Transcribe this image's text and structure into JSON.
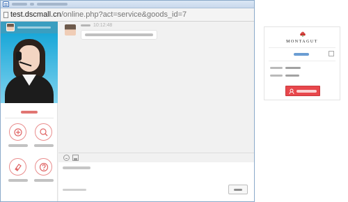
{
  "browser": {
    "url_host": "test.dscmall.cn",
    "url_path": "/online.php?act=service&goods_id=7"
  },
  "chat": {
    "messages": [
      {
        "time": "10:12:48"
      }
    ]
  },
  "store_card": {
    "brand": "MONTAGUT"
  },
  "colors": {
    "accent_blue": "#3a9ec0",
    "tool_red": "#e98c8c",
    "online_button_red": "#e8474c"
  },
  "icons": {
    "tools": [
      "favorites-icon",
      "orders-icon",
      "history-icon",
      "help-icon"
    ],
    "input": [
      "emoji-icon",
      "image-icon"
    ],
    "card": [
      "logo-flower-icon",
      "share-icon",
      "customer-service-icon"
    ]
  }
}
